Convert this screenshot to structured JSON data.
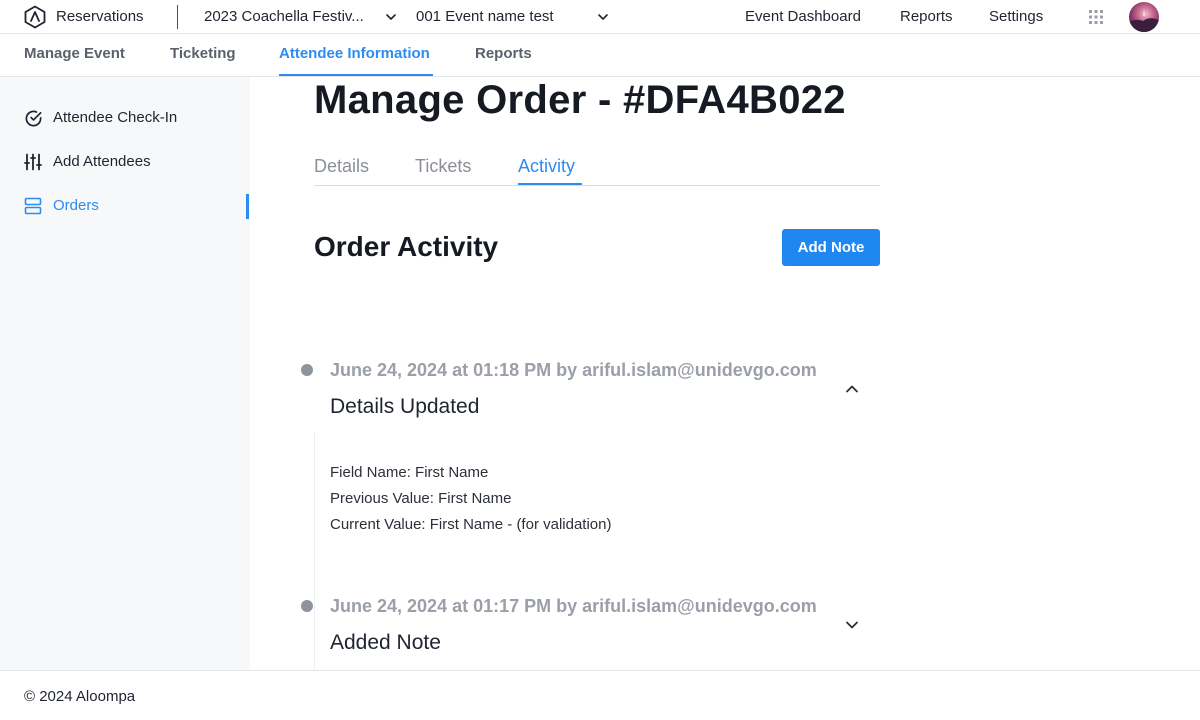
{
  "app": {
    "title": "Reservations",
    "event_select": "2023 Coachella Festiv...",
    "event_name_select": "001 Event name test",
    "avatar_icon": "user-avatar"
  },
  "topnav": {
    "items": [
      "Event Dashboard",
      "Reports",
      "Settings"
    ],
    "apps_icon": "apps-grid-icon"
  },
  "subnav": {
    "tabs": [
      "Manage Event",
      "Ticketing",
      "Attendee Information",
      "Reports"
    ],
    "active": "Attendee Information"
  },
  "sidebar": {
    "items": [
      {
        "label": "Attendee Check-In",
        "icon": "check-circle-icon"
      },
      {
        "label": "Add Attendees",
        "icon": "sliders-icon"
      },
      {
        "label": "Orders",
        "icon": "server-stack-icon"
      }
    ],
    "active": "Orders"
  },
  "main": {
    "title": "Manage Order - #DFA4B022",
    "tabs": [
      "Details",
      "Tickets",
      "Activity"
    ],
    "active_tab": "Activity",
    "section_title": "Order Activity",
    "add_note_label": "Add Note",
    "activities": [
      {
        "meta": "June 24, 2024 at 01:18 PM by ariful.islam@unidevgo.com",
        "heading": "Details Updated",
        "expanded": true,
        "details": [
          "Field Name: First Name",
          "Previous Value: First Name",
          "Current Value: First Name - (for validation)"
        ]
      },
      {
        "meta": "June 24, 2024 at 01:17 PM by ariful.islam@unidevgo.com",
        "heading": "Added Note",
        "expanded": false
      }
    ]
  },
  "footer": {
    "text": "© 2024 Aloompa"
  },
  "colors": {
    "accent": "#2d8cf0",
    "button": "#1e87f0"
  }
}
